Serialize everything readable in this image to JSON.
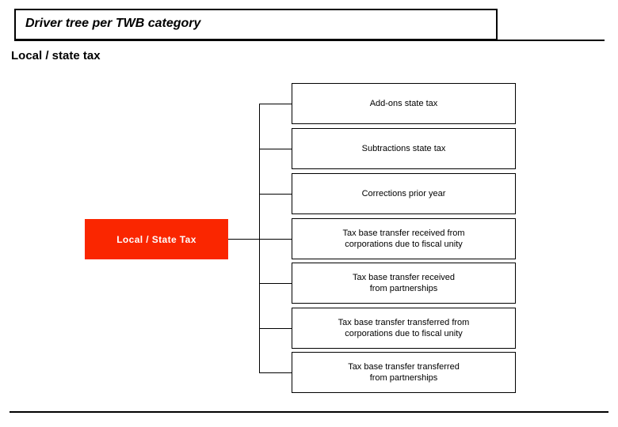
{
  "slide": {
    "title": "Driver tree per TWB category",
    "subtitle": "Local / state tax"
  },
  "colors": {
    "root_fill": "#fa2600",
    "root_text": "#ffffff",
    "line": "#000000",
    "background": "#ffffff"
  },
  "tree": {
    "root": {
      "label": "Local / State Tax"
    },
    "children": [
      {
        "label": "Add-ons state tax",
        "lines": [
          "Add-ons state tax"
        ]
      },
      {
        "label": "Subtractions state tax",
        "lines": [
          "Subtractions state tax"
        ]
      },
      {
        "label": "Corrections prior year",
        "lines": [
          "Corrections prior year"
        ]
      },
      {
        "label": "Tax base transfer received from corporations due to fiscal unity",
        "lines": [
          "Tax base transfer received from",
          "corporations due to fiscal unity"
        ]
      },
      {
        "label": "Tax base transfer received from partnerships",
        "lines": [
          "Tax base transfer received",
          "from partnerships"
        ]
      },
      {
        "label": "Tax base transfer transferred from corporations due to fiscal unity",
        "lines": [
          "Tax base transfer transferred from",
          "corporations due to fiscal unity"
        ]
      },
      {
        "label": "Tax base transfer transferred from partnerships",
        "lines": [
          "Tax base transfer transferred",
          "from partnerships"
        ]
      }
    ]
  }
}
